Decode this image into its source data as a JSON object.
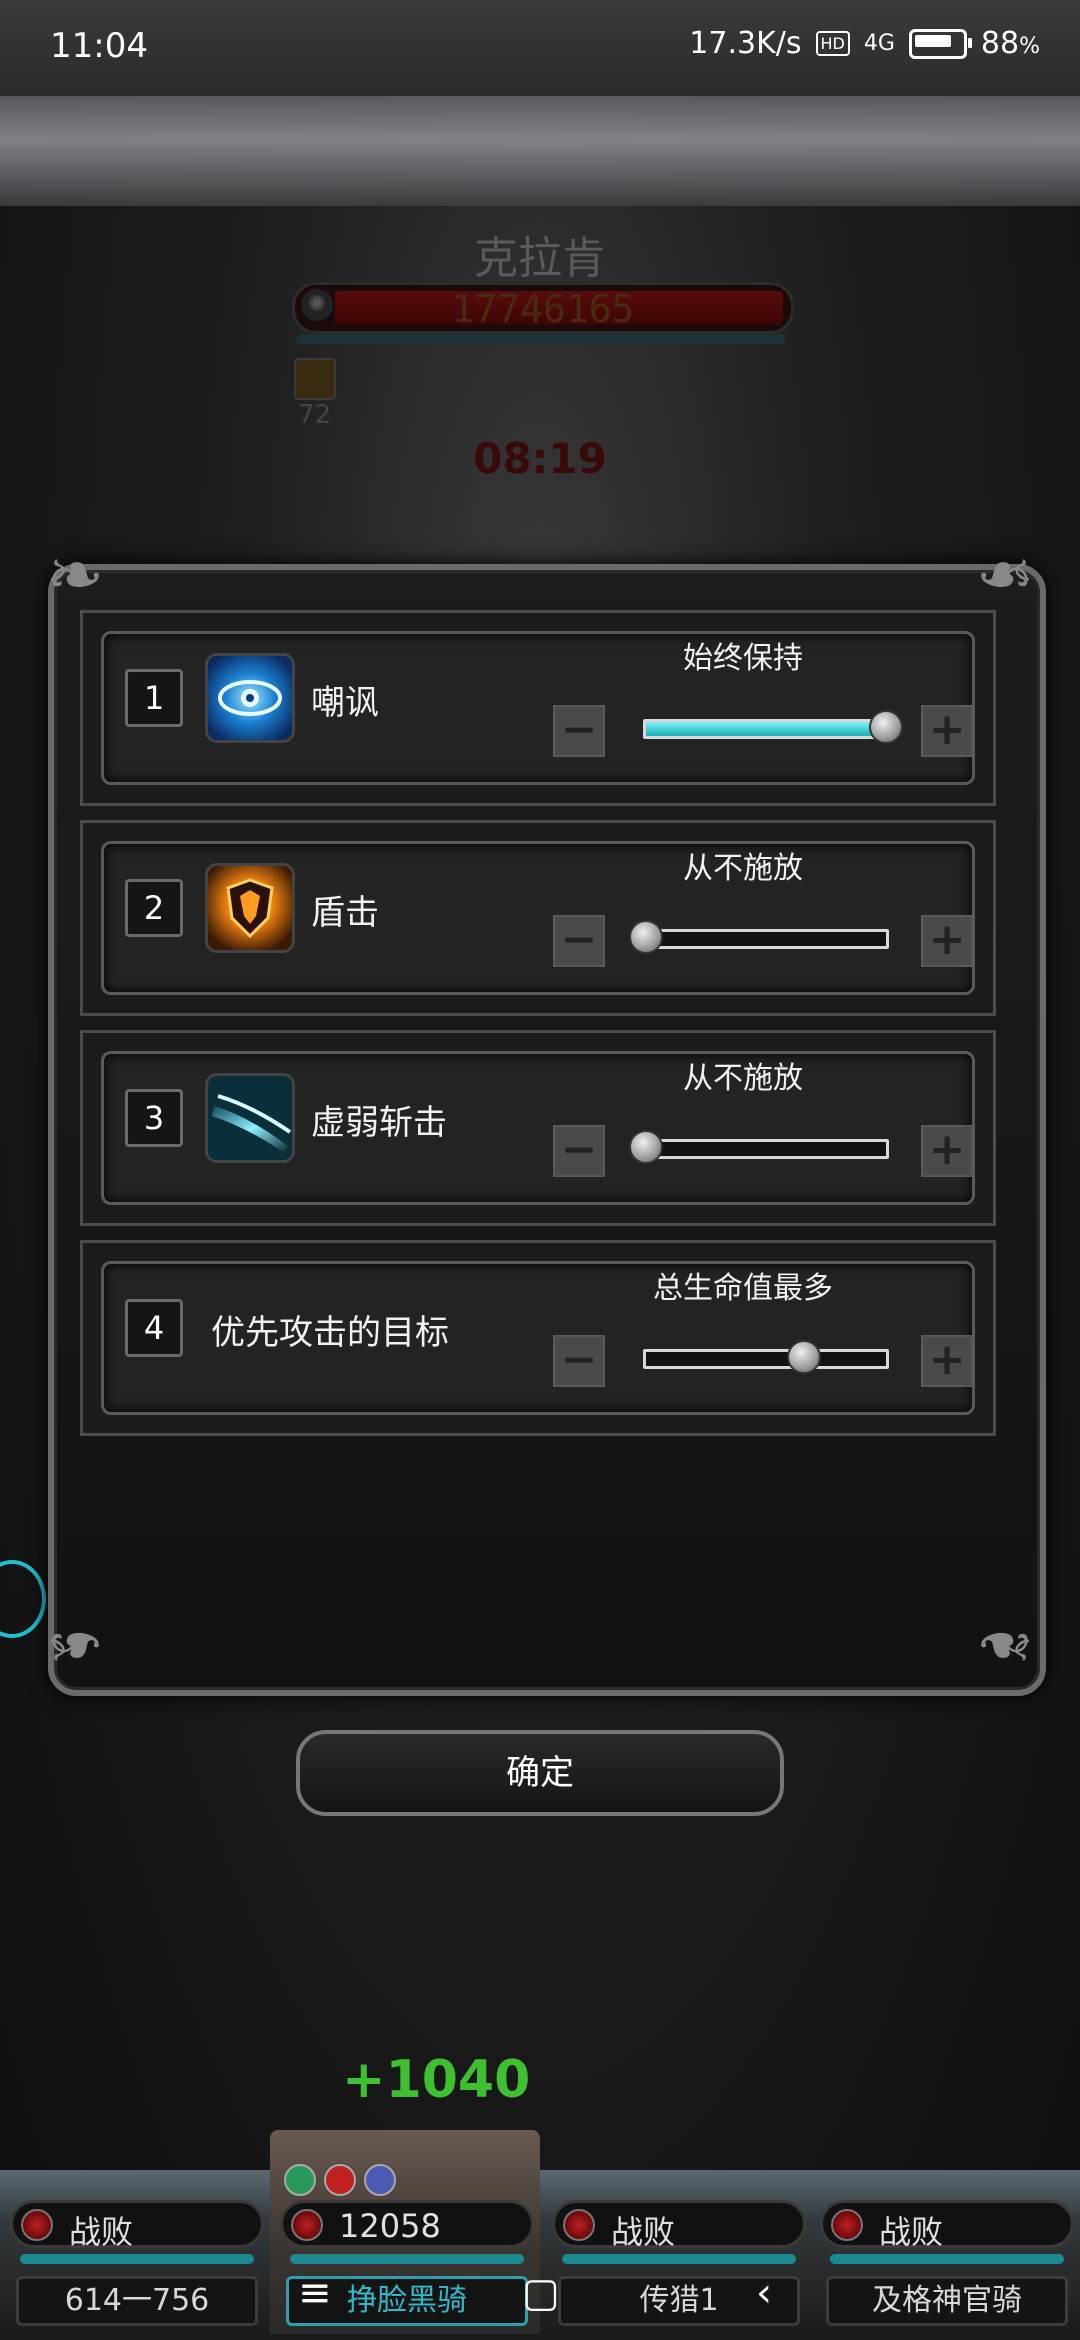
{
  "status_bar": {
    "time": "11:04",
    "net_speed": "17.3K/s",
    "hd": "HD",
    "signal": "4G",
    "battery": "88",
    "battery_unit": "%"
  },
  "boss": {
    "name": "克拉肯",
    "hp": "17746165",
    "buff_count": "72",
    "timer": "08:19"
  },
  "rows": [
    {
      "index": "1",
      "name": "嘲讽",
      "mode": "始终保持",
      "level": 1.0
    },
    {
      "index": "2",
      "name": "盾击",
      "mode": "从不施放",
      "level": 0.0
    },
    {
      "index": "3",
      "name": "虚弱斩击",
      "mode": "从不施放",
      "level": 0.0
    },
    {
      "index": "4",
      "name": "优先攻击的目标",
      "mode": "总生命值最多",
      "level": 0.66
    }
  ],
  "step_buttons": {
    "minus": "−",
    "plus": "+"
  },
  "confirm_label": "确定",
  "heal_text": "+1040",
  "party": [
    {
      "status": "战败",
      "name": "614一756"
    },
    {
      "status": "12058",
      "name": "挣脸黑骑"
    },
    {
      "status": "战败",
      "name": "传猎1"
    },
    {
      "status": "战败",
      "name": "及格神官骑"
    }
  ],
  "nav": {
    "menu": "≡",
    "home": "▢",
    "back": "‹"
  },
  "colors": {
    "accent": "#1bb0b8",
    "heal": "#3ec030"
  }
}
